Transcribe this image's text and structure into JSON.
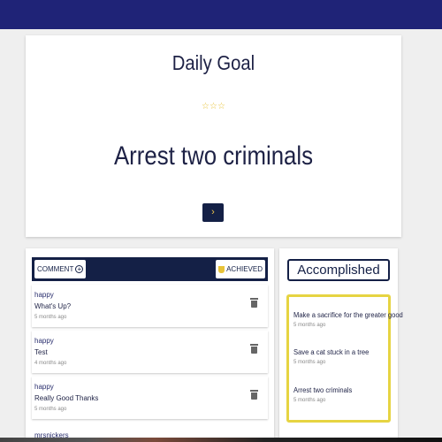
{
  "goal": {
    "header": "Daily Goal",
    "stars": "☆☆☆",
    "text": "Arrest two criminals",
    "next_label": "›"
  },
  "comments_panel": {
    "comment_label": "COMMENT",
    "achieved_label": "ACHIEVED",
    "items": [
      {
        "mood": "happy",
        "text": "What's Up?",
        "time": "5 months ago"
      },
      {
        "mood": "happy",
        "text": "Test",
        "time": "4 months ago"
      },
      {
        "mood": "happy",
        "text": "Really Good Thanks",
        "time": "5 months ago"
      }
    ],
    "partial_item_mood": "mrsnickers"
  },
  "accomplished": {
    "header": "Accomplished",
    "items": [
      {
        "text": "Make a sacrifice for the greater good",
        "time": "5 months ago"
      },
      {
        "text": "Save a cat stuck in a tree",
        "time": "5 months ago"
      },
      {
        "text": "Arrest two criminals",
        "time": "5 months ago"
      }
    ]
  },
  "icons": {
    "next": "chevron-right-icon",
    "add": "plus-circle-icon",
    "trophy": "trophy-icon",
    "delete": "trash-icon"
  },
  "colors": {
    "topbar": "#1f2377",
    "navy": "#142046",
    "gold": "#e8c338",
    "accomplished_border": "#e6d442"
  }
}
